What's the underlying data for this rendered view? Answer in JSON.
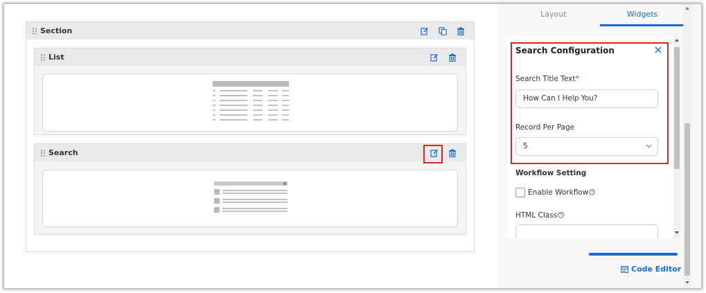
{
  "section": {
    "title": "Section"
  },
  "list_widget": {
    "title": "List"
  },
  "search_widget": {
    "title": "Search"
  },
  "panel": {
    "tabs": [
      {
        "label": "Layout"
      },
      {
        "label": "Widgets",
        "active": true
      }
    ],
    "search_config": {
      "heading": "Search Configuration",
      "title_text_label": "Search Title Text",
      "required_mark": "*",
      "title_text_value": "How Can I Help You?",
      "record_per_page_label": "Record Per Page",
      "record_per_page_value": "5",
      "workflow_heading": "Workflow Setting",
      "enable_workflow_label": "Enable Workflow",
      "enable_workflow_checked": false,
      "html_class_label": "HTML Class",
      "html_class_value": ""
    },
    "code_editor_label": "Code Editor"
  },
  "colors": {
    "accent": "#1a6ad6",
    "highlight": "#e02424"
  }
}
